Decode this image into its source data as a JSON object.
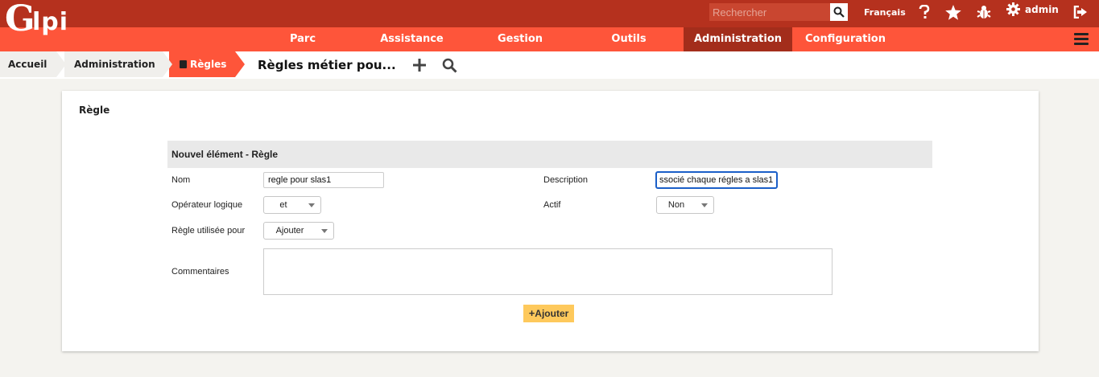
{
  "header": {
    "logo_text": "Glpi",
    "search_placeholder": "Rechercher",
    "language": "Français",
    "user": "admin",
    "icons": [
      "search-icon",
      "help-icon",
      "star-icon",
      "bug-icon",
      "gear-icon",
      "logout-icon"
    ]
  },
  "nav": {
    "items": [
      "Parc",
      "Assistance",
      "Gestion",
      "Outils",
      "Administration",
      "Configuration"
    ],
    "active": "Administration"
  },
  "breadcrumb": {
    "items": [
      "Accueil",
      "Administration",
      "Règles"
    ],
    "page_title": "Règles métier pou..."
  },
  "card": {
    "title": "Règle",
    "form_title": "Nouvel élément - Règle",
    "labels": {
      "nom": "Nom",
      "description": "Description",
      "operateur": "Opérateur logique",
      "actif": "Actif",
      "utilisee": "Règle utilisée pour",
      "commentaires": "Commentaires"
    },
    "values": {
      "nom": "regle pour slas1",
      "description": "ssocié chaque régles a slas1",
      "operateur": "et",
      "actif": "Non",
      "utilisee": "Ajouter",
      "commentaires": ""
    },
    "submit_label": "Ajouter"
  },
  "colors": {
    "top_bar": "#b5311e",
    "nav_bar": "#fe553a",
    "nav_active": "#a32d1b",
    "submit": "#fec95c",
    "focus": "#1b5fc8"
  }
}
